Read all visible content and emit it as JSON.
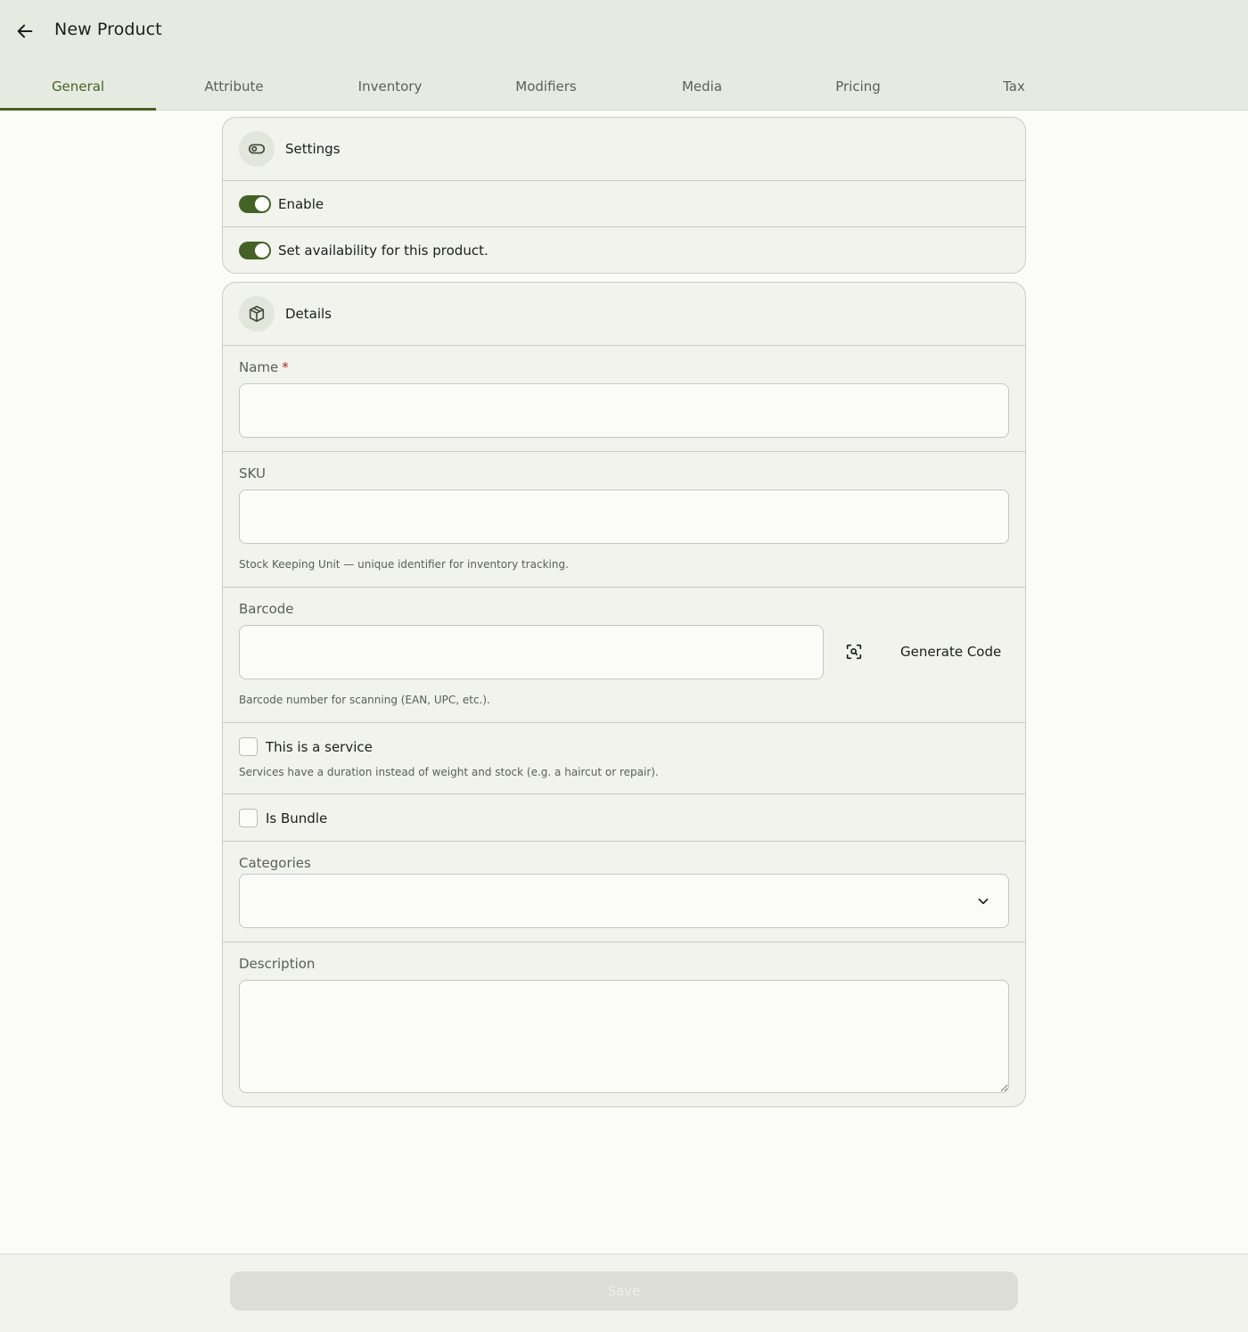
{
  "header": {
    "title": "New Product",
    "back_icon": "arrow-left-icon"
  },
  "tabs": [
    {
      "label": "General",
      "active": true
    },
    {
      "label": "Attribute",
      "active": false
    },
    {
      "label": "Inventory",
      "active": false
    },
    {
      "label": "Modifiers",
      "active": false
    },
    {
      "label": "Media",
      "active": false
    },
    {
      "label": "Pricing",
      "active": false
    },
    {
      "label": "Tax",
      "active": false
    }
  ],
  "settings": {
    "title": "Settings",
    "icon": "toggle-icon",
    "enable_label": "Enable",
    "enable_on": true,
    "availability_label": "Set availability for this product.",
    "availability_on": true
  },
  "details": {
    "title": "Details",
    "icon": "box-icon",
    "name": {
      "label": "Name",
      "required_mark": "*",
      "value": ""
    },
    "sku": {
      "label": "SKU",
      "value": "",
      "help": "Stock Keeping Unit — unique identifier for inventory tracking."
    },
    "barcode": {
      "label": "Barcode",
      "value": "",
      "help": "Barcode number for scanning (EAN, UPC, etc.).",
      "generate_label": "Generate Code",
      "scan_icon": "scan-icon"
    },
    "service": {
      "label": "This is a service",
      "checked": false,
      "help": "Services have a duration instead of weight and stock (e.g. a haircut or repair)."
    },
    "bundle": {
      "label": "Is Bundle",
      "checked": false
    },
    "categories": {
      "label": "Categories",
      "value": ""
    },
    "description": {
      "label": "Description",
      "value": ""
    }
  },
  "footer": {
    "save_label": "Save"
  },
  "colors": {
    "accent": "#446226",
    "header_bg": "#e6ebe1",
    "card_bg": "#f1f3ec",
    "page_bg": "#fbfcf8"
  }
}
